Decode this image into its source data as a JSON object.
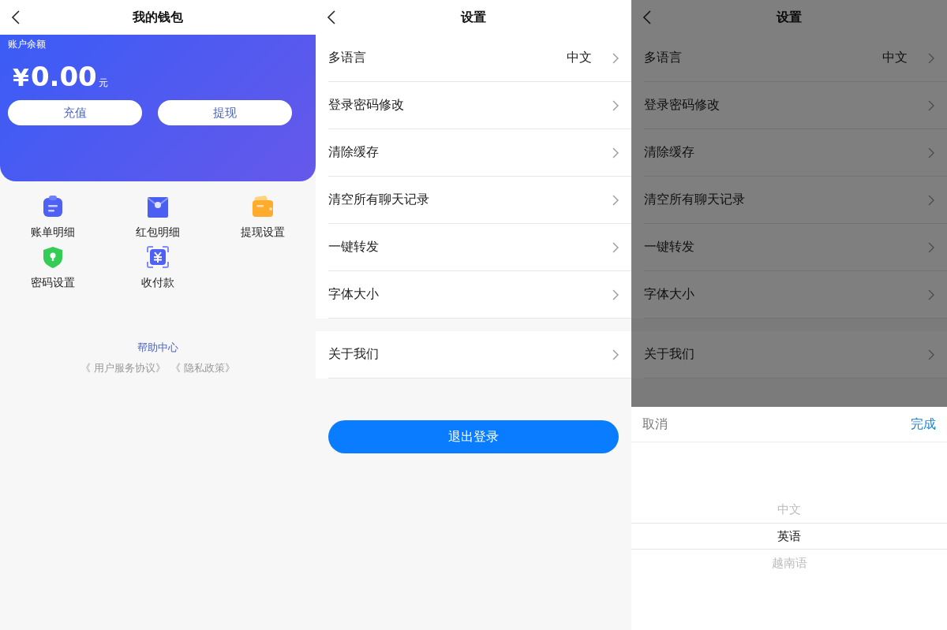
{
  "wallet": {
    "title": "我的钱包",
    "balance_label": "账户余额",
    "currency": "¥",
    "amount": "0.00",
    "unit": "元",
    "actions": [
      "充值",
      "提现"
    ],
    "shortcuts": [
      {
        "label": "账单明细",
        "kind": "clipboard"
      },
      {
        "label": "红包明细",
        "kind": "envelope"
      },
      {
        "label": "提现设置",
        "kind": "wallet"
      },
      {
        "label": "密码设置",
        "kind": "shield"
      },
      {
        "label": "收付款",
        "kind": "scan"
      }
    ],
    "help_link": "帮助中心",
    "agreements": [
      "《 用户服务协议》",
      "《 隐私政策》"
    ]
  },
  "settings": {
    "title": "设置",
    "groups": [
      [
        {
          "label": "多语言",
          "value": "中文"
        },
        {
          "label": "登录密码修改"
        },
        {
          "label": "清除缓存"
        },
        {
          "label": "清空所有聊天记录"
        },
        {
          "label": "一键转发"
        },
        {
          "label": "字体大小"
        }
      ],
      [
        {
          "label": "关于我们"
        }
      ]
    ],
    "logout": "退出登录"
  },
  "language_screen": {
    "title": "设置",
    "groups": [
      [
        {
          "label": "多语言",
          "value": "中文"
        },
        {
          "label": "登录密码修改"
        },
        {
          "label": "清除缓存"
        },
        {
          "label": "清空所有聊天记录"
        },
        {
          "label": "一键转发"
        },
        {
          "label": "字体大小"
        }
      ],
      [
        {
          "label": "关于我们"
        }
      ]
    ],
    "picker": {
      "cancel": "取消",
      "confirm": "完成",
      "options": [
        {
          "label": "中文",
          "selected": false
        },
        {
          "label": "英语",
          "selected": true
        },
        {
          "label": "越南语",
          "selected": false
        }
      ]
    }
  }
}
